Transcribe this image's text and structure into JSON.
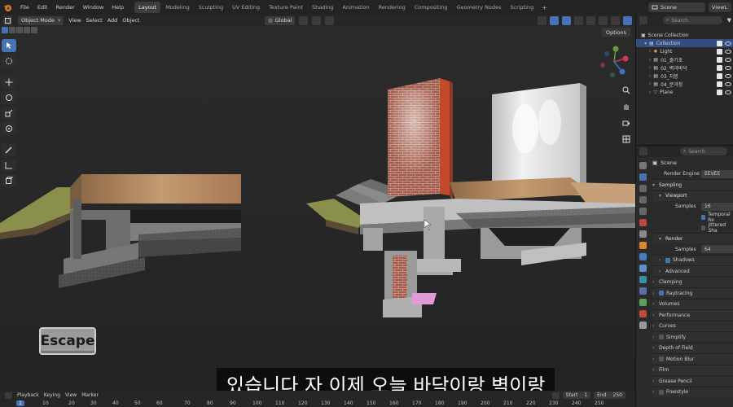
{
  "menu": {
    "items": [
      "File",
      "Edit",
      "Render",
      "Window",
      "Help"
    ]
  },
  "workspaces": {
    "tabs": [
      "Layout",
      "Modeling",
      "Sculpting",
      "UV Editing",
      "Texture Paint",
      "Shading",
      "Animation",
      "Rendering",
      "Compositing",
      "Geometry Nodes",
      "Scripting"
    ],
    "active": "Layout",
    "add": "+"
  },
  "topbar": {
    "scene": "Scene",
    "view_layer": "ViewL"
  },
  "viewport": {
    "mode": "Object Mode",
    "menus": [
      "View",
      "Select",
      "Add",
      "Object"
    ],
    "transform": "Global",
    "options": "Options"
  },
  "overlay": {
    "key": "Escape",
    "subtitle": "있습니다 자 이제 오늘 바닥이랑 벽이랑"
  },
  "outliner": {
    "search_placeholder": "Search",
    "rows": [
      {
        "label": "Scene Collection",
        "indent": 0,
        "selected": false
      },
      {
        "label": "Collection",
        "indent": 1,
        "selected": true
      },
      {
        "label": "Light",
        "indent": 2,
        "selected": false
      },
      {
        "label": "01_줄기초",
        "indent": 2,
        "selected": false
      },
      {
        "label": "02_벽과바닥",
        "indent": 2,
        "selected": false
      },
      {
        "label": "03_지붕",
        "indent": 2,
        "selected": false
      },
      {
        "label": "04_문과창",
        "indent": 2,
        "selected": false
      },
      {
        "label": "Plane",
        "indent": 2,
        "selected": false
      }
    ]
  },
  "properties": {
    "search_placeholder": "Search",
    "scene_label": "Scene",
    "render_engine_label": "Render Engine",
    "render_engine_value": "EEVEE",
    "sampling": "Sampling",
    "viewport_label": "Viewport",
    "viewport_samples_label": "Samples",
    "viewport_samples_value": "16",
    "temporal_reprojection": "Temporal Re",
    "jittered_shadows": "Jittered Sha",
    "render_label": "Render",
    "render_samples_label": "Samples",
    "render_samples_value": "64",
    "shadows": "Shadows",
    "advanced": "Advanced",
    "clamping": "Clamping",
    "raytracing": "Raytracing",
    "volumes": "Volumes",
    "performance": "Performance",
    "curves": "Curves",
    "simplify": "Simplify",
    "depth_of_field": "Depth of Field",
    "motion_blur": "Motion Blur",
    "film": "Film",
    "grease_pencil": "Grease Pencil",
    "freestyle": "Freestyle"
  },
  "timeline": {
    "playback": "Playback",
    "keying": "Keying",
    "view": "View",
    "marker": "Marker",
    "start_label": "Start",
    "start_value": "1",
    "end_label": "End",
    "end_value": "250",
    "current_frame": "1",
    "ticks": [
      "10",
      "20",
      "30",
      "40",
      "50",
      "60",
      "70",
      "80",
      "90",
      "100",
      "110",
      "120",
      "130",
      "140",
      "150",
      "160",
      "170",
      "180",
      "190",
      "200",
      "210",
      "220",
      "230",
      "240",
      "250"
    ]
  },
  "colors": {
    "accent": "#4772b3",
    "panel": "#2b2b2b",
    "viewport_bg": "#2a2a2a",
    "floor_wood": "#b88a5c",
    "brick": "#a8584a",
    "concrete": "#8a8a8a",
    "grass": "#8b8f4c"
  }
}
